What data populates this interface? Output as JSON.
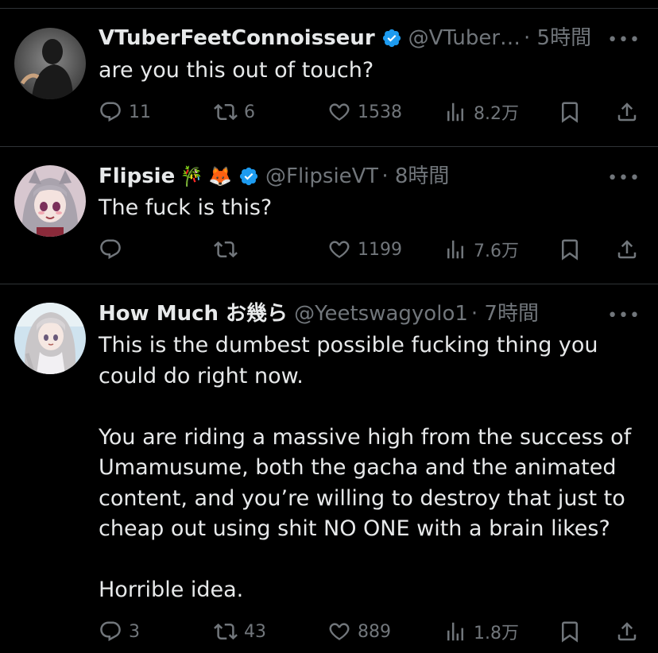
{
  "tweets": [
    {
      "display_name": "VTuberFeetConnoisseur",
      "verified": true,
      "emojis": [],
      "handle": "@VTuber…",
      "time": "· 5時間",
      "text": "are you this out of touch?",
      "reply_count": "11",
      "retweet_count": "6",
      "like_count": "1538",
      "view_count": "8.2万",
      "avatar": "shadow-silhouette"
    },
    {
      "display_name": "Flipsie",
      "verified": true,
      "emojis": [
        "🎋",
        "🦊"
      ],
      "handle": "@FlipsieVT",
      "time": "· 8時間",
      "text": "The fuck is this?",
      "reply_count": "",
      "retweet_count": "",
      "like_count": "1199",
      "view_count": "7.6万",
      "avatar": "anime-girl-grey-hair"
    },
    {
      "display_name": "How Much お幾ら",
      "verified": false,
      "emojis": [],
      "handle": "@Yeetswagyolo1",
      "time": "· 7時間",
      "text": "This is the dumbest possible fucking thing you could do right now.\n\nYou are riding a massive high from the success of Umamusume, both the gacha and the animated content, and you’re willing to destroy that just to cheap out using shit NO ONE with a brain likes?\n\nHorrible idea.",
      "reply_count": "3",
      "retweet_count": "43",
      "like_count": "889",
      "view_count": "1.8万",
      "avatar": "anime-girl-long-hair"
    }
  ],
  "more_label": "•••",
  "colors": {
    "background": "#000000",
    "primary_text": "#e7e9ea",
    "secondary_text": "#71767b",
    "verified_blue": "#1d9bf0",
    "divider": "#2f3336"
  }
}
